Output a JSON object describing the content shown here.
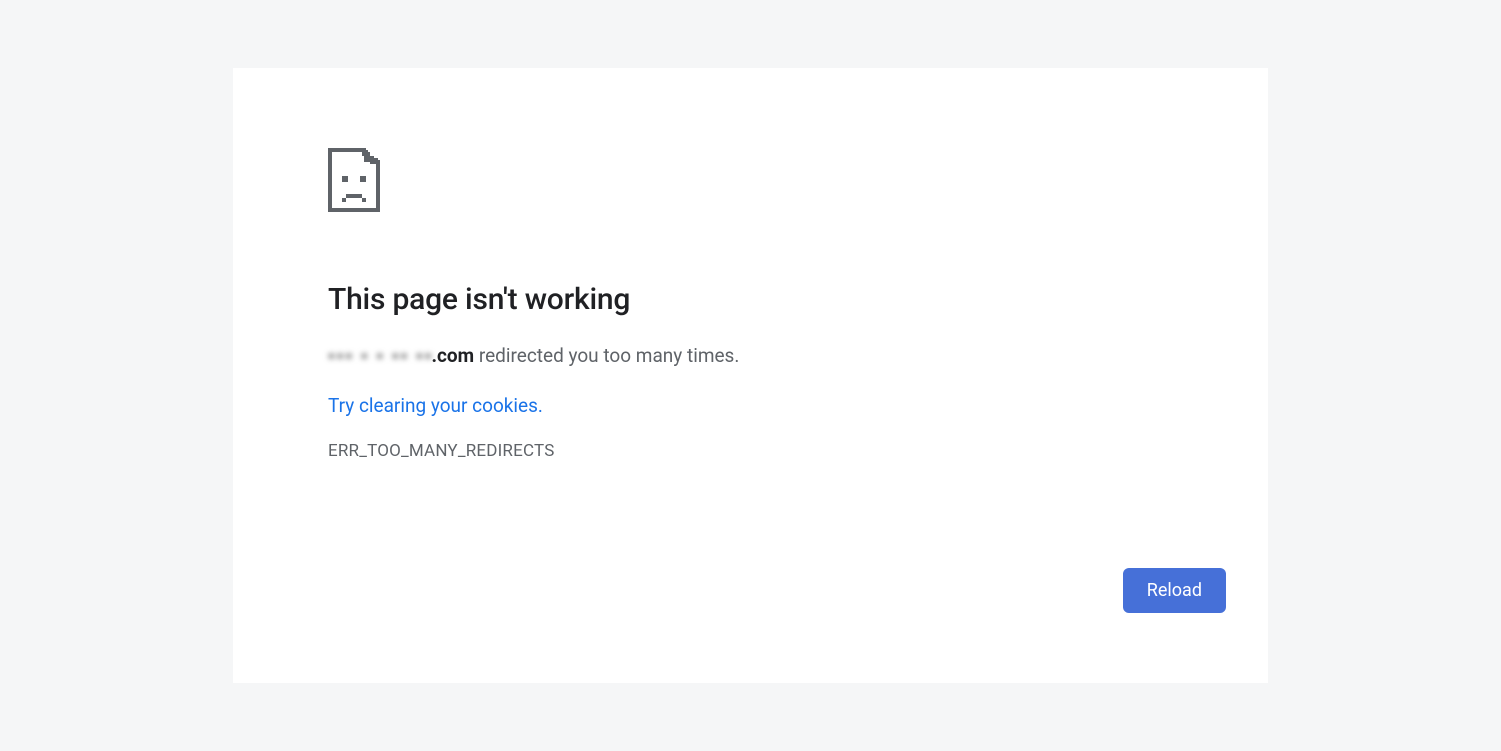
{
  "error": {
    "heading": "This page isn't working",
    "host_obscured": "▪▪▪ ▪ ▪ ▪▪ ▪▪",
    "host_suffix": ".com",
    "redirect_msg": " redirected you too many times.",
    "suggestion_link": "Try clearing your cookies",
    "suggestion_dot": ".",
    "code": "ERR_TOO_MANY_REDIRECTS",
    "reload_label": "Reload"
  }
}
